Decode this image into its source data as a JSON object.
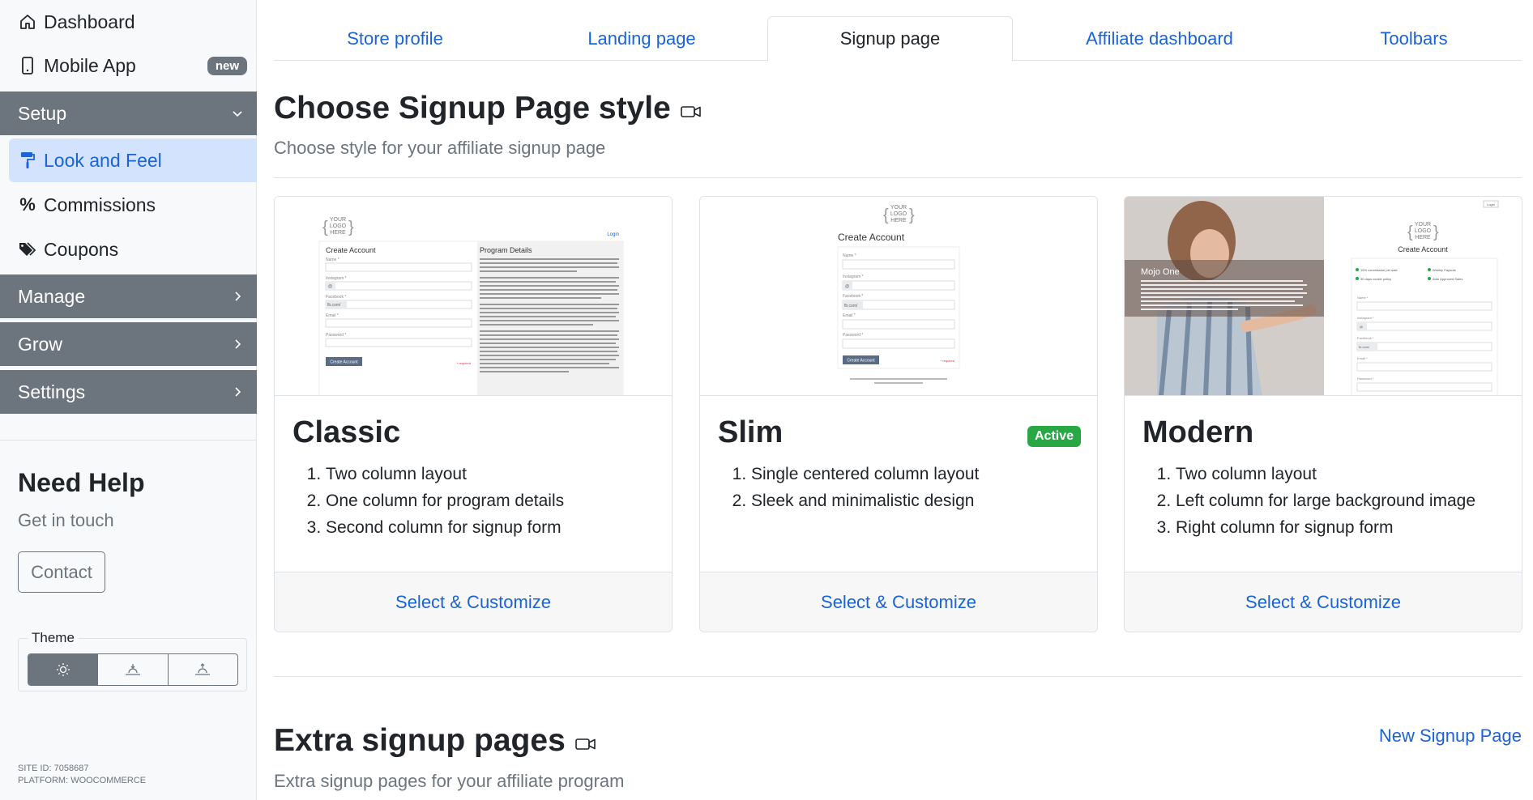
{
  "sidebar": {
    "dashboard": "Dashboard",
    "mobile_app": "Mobile App",
    "mobile_badge": "new",
    "setup": "Setup",
    "look_and_feel": "Look and Feel",
    "commissions": "Commissions",
    "coupons": "Coupons",
    "manage": "Manage",
    "grow": "Grow",
    "settings": "Settings",
    "help_title": "Need Help",
    "help_sub": "Get in touch",
    "contact": "Contact",
    "theme_label": "Theme",
    "theme_selected": "light",
    "site_id": "SITE ID: 7058687",
    "platform": "PLATFORM: WOOCOMMERCE"
  },
  "tabs": [
    {
      "label": "Store profile",
      "active": false
    },
    {
      "label": "Landing page",
      "active": false
    },
    {
      "label": "Signup page",
      "active": true
    },
    {
      "label": "Affiliate dashboard",
      "active": false
    },
    {
      "label": "Toolbars",
      "active": false
    }
  ],
  "main": {
    "title": "Choose Signup Page style",
    "subtitle": "Choose style for your affiliate signup page",
    "extra_title": "Extra signup pages",
    "extra_subtitle": "Extra signup pages for your affiliate program",
    "new_signup_link": "New Signup Page"
  },
  "cards": [
    {
      "title": "Classic",
      "active": false,
      "features": [
        "Two column layout",
        "One column for program details",
        "Second column for signup form"
      ],
      "cta": "Select & Customize"
    },
    {
      "title": "Slim",
      "active": true,
      "badge": "Active",
      "features": [
        "Single centered column layout",
        "Sleek and minimalistic design"
      ],
      "cta": "Select & Customize"
    },
    {
      "title": "Modern",
      "active": false,
      "features": [
        "Two column layout",
        "Left column for large background image",
        "Right column for signup form"
      ],
      "cta": "Select & Customize"
    }
  ],
  "previews": {
    "logo_text": [
      "YOUR",
      "LOGO",
      "HERE"
    ],
    "create_account": "Create Account",
    "program_details": "Program Details",
    "login": "Login",
    "name": "Name *",
    "instagram": "Instagram *",
    "facebook": "Facebook *",
    "email": "Email *",
    "password": "Password *",
    "fb_prefix": "fb.com/",
    "at": "@",
    "required": "* required",
    "create_btn": "Create Account",
    "modern_brand": "Mojo One",
    "perk_1": "15% commission per sale",
    "perk_2": "Weekly Payouts",
    "perk_3": "30 days cookie policy",
    "perk_4": "Auto Approved Sales"
  },
  "colors": {
    "accent": "#1a63d8",
    "section_bg": "#6c757d",
    "active_badge": "#28a745",
    "active_nav_bg": "#d3e3fd"
  }
}
